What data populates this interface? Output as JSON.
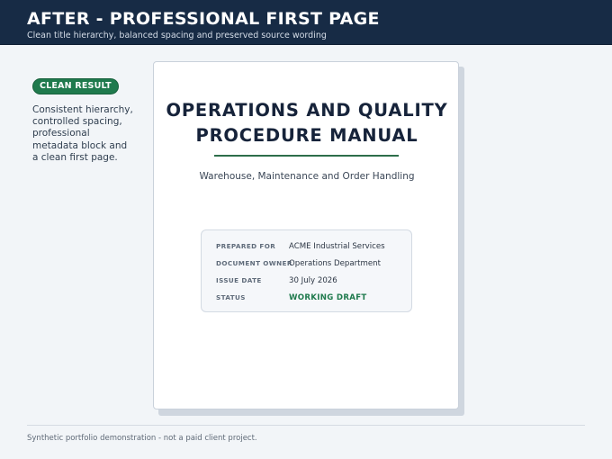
{
  "header": {
    "title": "AFTER - PROFESSIONAL FIRST PAGE",
    "subtitle": "Clean title hierarchy, balanced spacing and preserved source wording"
  },
  "sidebar": {
    "badge": "CLEAN RESULT",
    "badge_color": "#1f7a4d",
    "note_lines": [
      "Consistent hierarchy,",
      "controlled spacing,",
      "professional",
      "metadata block and",
      "a clean first page."
    ]
  },
  "document": {
    "title_lines": [
      "OPERATIONS AND QUALITY",
      "PROCEDURE MANUAL"
    ],
    "subtitle": "Warehouse, Maintenance and Order Handling",
    "metadata": [
      {
        "label": "PREPARED FOR",
        "value": "ACME Industrial Services"
      },
      {
        "label": "DOCUMENT OWNER",
        "value": "Operations Department"
      },
      {
        "label": "ISSUE DATE",
        "value": "30 July 2026"
      },
      {
        "label": "STATUS",
        "value": "WORKING DRAFT"
      }
    ],
    "accent_color": "#2d6e4a"
  },
  "footer": {
    "text": "Synthetic portfolio demonstration - not a paid client project."
  }
}
